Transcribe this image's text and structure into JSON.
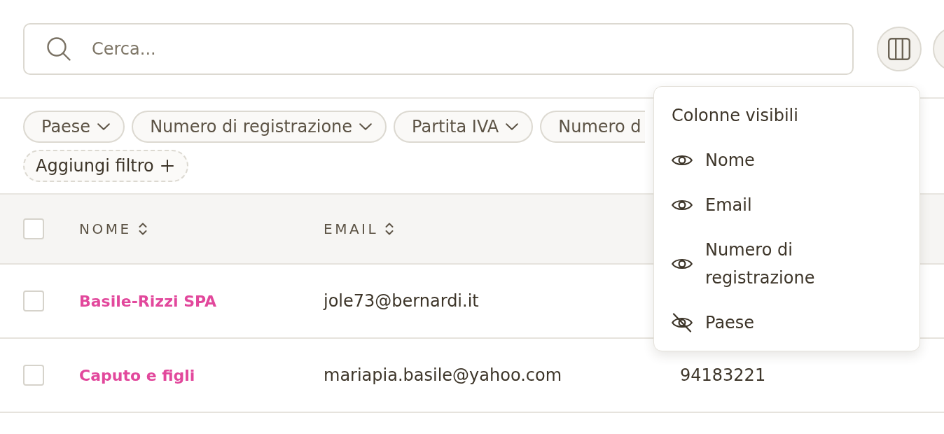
{
  "search": {
    "placeholder": "Cerca..."
  },
  "filters": [
    {
      "kind": "dropdown",
      "label": "Paese",
      "clipped": false
    },
    {
      "kind": "dropdown",
      "label": "Numero di registrazione",
      "clipped": false
    },
    {
      "kind": "dropdown",
      "label": "Partita IVA",
      "clipped": false
    },
    {
      "kind": "dropdown",
      "label": "Numero d",
      "clipped": true
    },
    {
      "kind": "add",
      "label": "Aggiungi filtro",
      "clipped": false
    }
  ],
  "table": {
    "select_all": {
      "checked": false
    },
    "columns": [
      {
        "label": "NOME",
        "sortable": true
      },
      {
        "label": "EMAIL",
        "sortable": true
      }
    ],
    "rows": [
      {
        "selected": false,
        "name": "Basile-Rizzi SPA",
        "email": "jole73@bernardi.it"
      },
      {
        "selected": false,
        "name": "Caputo e figli",
        "email": "mariapia.basile@yahoo.com",
        "column_3": "94183221"
      }
    ]
  },
  "column_menu": {
    "title": "Colonne visibili",
    "items": [
      {
        "label": "Nome",
        "visible": true
      },
      {
        "label": "Email",
        "visible": true
      },
      {
        "label": "Numero di registrazione",
        "visible": true
      },
      {
        "label": "Paese",
        "visible": false
      }
    ]
  }
}
